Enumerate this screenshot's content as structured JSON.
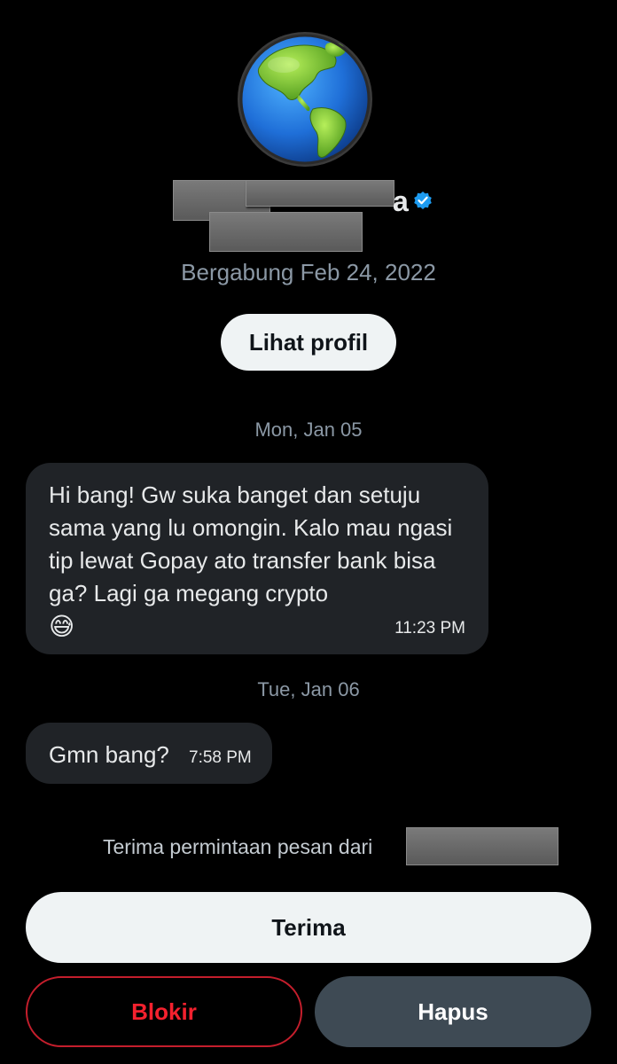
{
  "profile": {
    "name_visible_tail": "a",
    "verified": true,
    "joined": "Bergabung Feb 24, 2022",
    "view_profile_label": "Lihat profil",
    "avatar_icon": "earth-globe-americas-icon"
  },
  "conversation": {
    "days": [
      {
        "date": "Mon, Jan 05",
        "messages": [
          {
            "text": "Hi bang! Gw suka banget dan setuju sama yang lu omongin. Kalo mau ngasi tip lewat Gopay ato transfer bank bisa ga? Lagi ga megang crypto",
            "emoji": "😅",
            "time": "11:23 PM"
          }
        ]
      },
      {
        "date": "Tue, Jan 06",
        "messages": [
          {
            "text": "Gmn bang?",
            "time": "7:58 PM"
          }
        ]
      }
    ]
  },
  "request": {
    "prompt": "Terima permintaan pesan dari",
    "accept_label": "Terima",
    "block_label": "Blokir",
    "delete_label": "Hapus"
  },
  "colors": {
    "background": "#000000",
    "bubble": "#202327",
    "muted_text": "#8b98a5",
    "verified_blue": "#1d9bf0",
    "block_red": "#f4212e",
    "delete_button": "#3e4a54"
  }
}
